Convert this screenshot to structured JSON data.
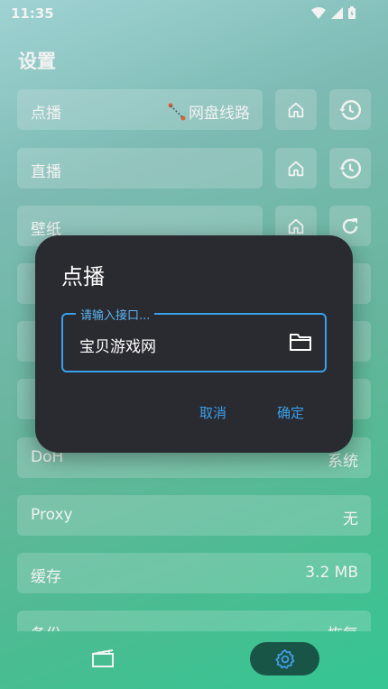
{
  "status": {
    "time": "11:35",
    "icons": [
      "wifi-icon",
      "signal-icon",
      "battery-icon"
    ]
  },
  "page": {
    "title": "设置"
  },
  "rows": [
    {
      "label": "点播",
      "value": "网盘线路",
      "value_icon": "route-icon"
    },
    {
      "label": "直播",
      "value": ""
    },
    {
      "label": "壁纸",
      "value": ""
    },
    {
      "label": "DoH",
      "value": "系统"
    },
    {
      "label": "Proxy",
      "value": "无"
    },
    {
      "label": "缓存",
      "value": "3.2 MB"
    },
    {
      "label": "备份",
      "value": "恢复"
    }
  ],
  "dialog": {
    "title": "点播",
    "field_label": "请输入接口...",
    "field_value": "宝贝游戏网",
    "cancel": "取消",
    "confirm": "确定"
  },
  "nav": {
    "items": [
      "film-icon",
      "gear-icon"
    ],
    "active": "gear-icon"
  },
  "colors": {
    "dialog_bg": "#2a2a31",
    "accent": "#3aa0ea",
    "nav_active": "#1a5a4a"
  }
}
